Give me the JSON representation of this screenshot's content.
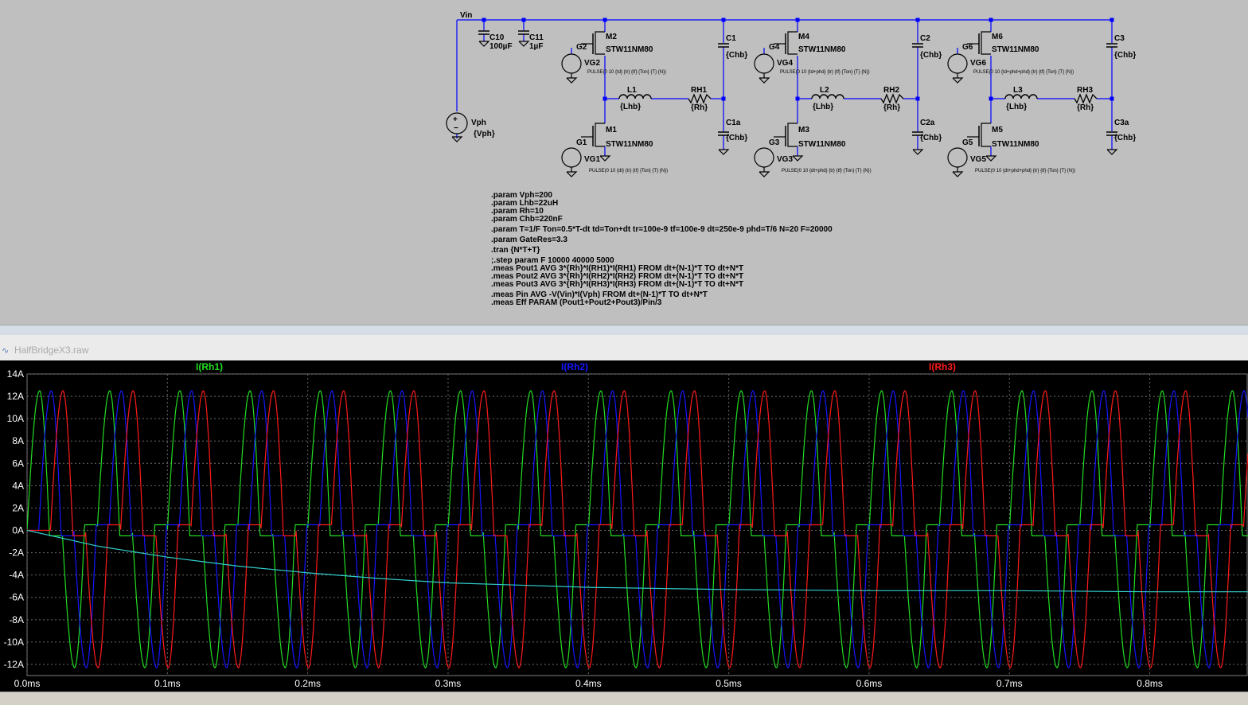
{
  "schematic": {
    "nets": {
      "vin": "Vin"
    },
    "source": {
      "name": "Vph",
      "value": "{Vph}"
    },
    "caps_input": [
      {
        "name": "C10",
        "value": "100µF"
      },
      {
        "name": "C11",
        "value": "1µF"
      }
    ],
    "legs": [
      {
        "high_fet": "M2",
        "high_gate": "G2",
        "high_src": "VG2",
        "high_model": "STW11NM80",
        "high_pulse": "PULSE(0 10 {td} {tr} {tf} {Ton} {T} {N})",
        "low_fet": "M1",
        "low_gate": "G1",
        "low_src": "VG1",
        "low_model": "STW11NM80",
        "low_pulse": "PULSE(0 10 {dt} {tr} {tf} {Ton} {T} {N})",
        "inductor": "L1",
        "inductor_value": "{Lhb}",
        "res": "RH1",
        "res_value": "{Rh}",
        "cap_top": "C1",
        "cap_top_value": "{Chb}",
        "cap_bot": "C1a",
        "cap_bot_value": "{Chb}"
      },
      {
        "high_fet": "M4",
        "high_gate": "G4",
        "high_src": "VG4",
        "high_model": "STW11NM80",
        "high_pulse": "PULSE(0 10 {td+phd} {tr} {tf} {Ton} {T} {N})",
        "low_fet": "M3",
        "low_gate": "G3",
        "low_src": "VG3",
        "low_model": "STW11NM80",
        "low_pulse": "PULSE(0 10 {dt+phd} {tr} {tf} {Ton} {T} {N})",
        "inductor": "L2",
        "inductor_value": "{Lhb}",
        "res": "RH2",
        "res_value": "{Rh}",
        "cap_top": "C2",
        "cap_top_value": "{Chb}",
        "cap_bot": "C2a",
        "cap_bot_value": "{Chb}"
      },
      {
        "high_fet": "M6",
        "high_gate": "G6",
        "high_src": "VG6",
        "high_model": "STW11NM80",
        "high_pulse": "PULSE(0 10 {td+phd+phd} {tr} {tf} {Ton} {T} {N})",
        "low_fet": "M5",
        "low_gate": "G5",
        "low_src": "VG5",
        "low_model": "STW11NM80",
        "low_pulse": "PULSE(0 10 {dt+phd+phd} {tr} {tf} {Ton} {T} {N})",
        "inductor": "L3",
        "inductor_value": "{Lhb}",
        "res": "RH3",
        "res_value": "{Rh}",
        "cap_top": "C3",
        "cap_top_value": "{Chb}",
        "cap_bot": "C3a",
        "cap_bot_value": "{Chb}"
      }
    ],
    "directives": [
      ".param Vph=200",
      ".param Lhb=22uH",
      ".param Rh=10",
      ".param Chb=220nF",
      ".param T=1/F Ton=0.5*T-dt td=Ton+dt tr=100e-9 tf=100e-9 dt=250e-9 phd=T/6 N=20 F=20000",
      ".param GateRes=3.3",
      ".tran {N*T+T}",
      ";.step param F 10000 40000 5000",
      ".meas Pout1 AVG 3*{Rh}*I(RH1)*I(RH1) FROM dt+(N-1)*T TO dt+N*T",
      ".meas Pout2 AVG 3*{Rh}*I(RH2)*I(RH2) FROM dt+(N-1)*T TO dt+N*T",
      ".meas Pout3 AVG 3*{Rh}*I(RH3)*I(RH3) FROM dt+(N-1)*T TO dt+N*T",
      ".meas Pin AVG -V(Vin)*I(Vph) FROM dt+(N-1)*T TO dt+N*T",
      ".meas Eff PARAM (Pout1+Pout2+Pout3)/Pin/3"
    ]
  },
  "waveform_window": {
    "title": "HalfBridgeX3.raw"
  },
  "chart_data": {
    "type": "line",
    "title": "",
    "xlabel": "",
    "ylabel": "",
    "xlim": [
      0,
      0.87
    ],
    "ylim": [
      -13,
      14
    ],
    "x_ticks": [
      "0.0ms",
      "0.1ms",
      "0.2ms",
      "0.3ms",
      "0.4ms",
      "0.5ms",
      "0.6ms",
      "0.7ms",
      "0.8ms"
    ],
    "x_tick_values": [
      0,
      0.1,
      0.2,
      0.3,
      0.4,
      0.5,
      0.6,
      0.7,
      0.8
    ],
    "y_ticks": [
      "14A",
      "12A",
      "10A",
      "8A",
      "6A",
      "4A",
      "2A",
      "0A",
      "-2A",
      "-4A",
      "-6A",
      "-8A",
      "-10A",
      "-12A"
    ],
    "y_tick_values": [
      14,
      12,
      10,
      8,
      6,
      4,
      2,
      0,
      -2,
      -4,
      -6,
      -8,
      -10,
      -12
    ],
    "grid": true,
    "background": "#000000",
    "series": [
      {
        "name": "I(Rh1)",
        "color": "#22dd22",
        "period_ms": 0.05,
        "phase_ms": 0.0,
        "peak_pos": 12.5,
        "peak_neg": -12.3
      },
      {
        "name": "I(Rh2)",
        "color": "#1515ff",
        "period_ms": 0.05,
        "phase_ms": 0.00833,
        "peak_pos": 12.5,
        "peak_neg": -12.3
      },
      {
        "name": "I(Rh3)",
        "color": "#ff1a1a",
        "period_ms": 0.05,
        "phase_ms": 0.01667,
        "peak_pos": 12.5,
        "peak_neg": -12.3
      },
      {
        "name": "",
        "color": "#33cccc",
        "x": [
          0,
          0.05,
          0.1,
          0.15,
          0.2,
          0.25,
          0.3,
          0.35,
          0.4,
          0.45,
          0.5,
          0.6,
          0.7,
          0.8,
          0.87
        ],
        "values": [
          0,
          -1.4,
          -2.4,
          -3.2,
          -3.8,
          -4.3,
          -4.7,
          -4.9,
          -5.1,
          -5.2,
          -5.3,
          -5.4,
          -5.4,
          -5.5,
          -5.5
        ]
      }
    ]
  }
}
